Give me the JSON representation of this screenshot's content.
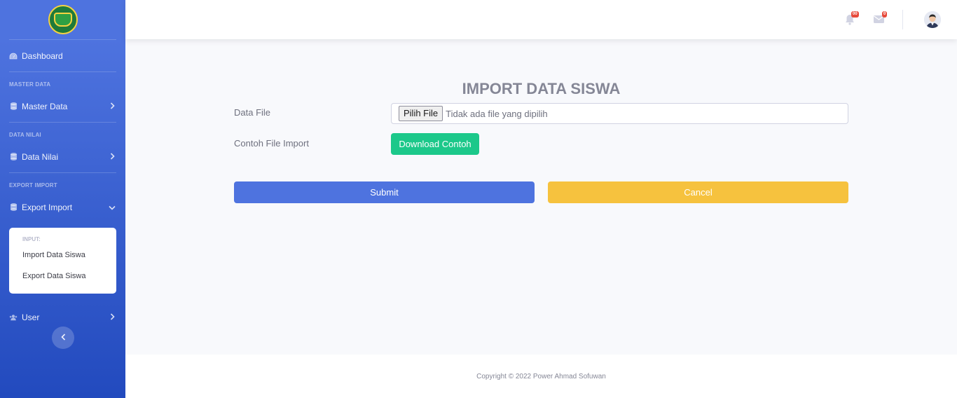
{
  "sidebar": {
    "logo_icon": "school-crest-logo",
    "dashboard_label": "Dashboard",
    "heading_master": "MASTER DATA",
    "master_label": "Master Data",
    "heading_nilai": "DATA NILAI",
    "nilai_label": "Data Nilai",
    "heading_export": "EXPORT IMPORT",
    "export_label": "Export Import",
    "submenu": {
      "heading": "INPUT:",
      "items": [
        "Import Data Siswa",
        "Export Data Siswa"
      ]
    },
    "user_label": "User",
    "toggle_icon": "chevron-left-icon"
  },
  "topbar": {
    "alerts_badge": "00",
    "messages_badge": "0"
  },
  "main": {
    "title": "IMPORT DATA SISWA",
    "data_file_label": "Data File",
    "file_button": "Pilih File",
    "file_status": "Tidak ada file yang dipilih",
    "example_label": "Contoh File Import",
    "download_button": "Download Contoh",
    "submit_button": "Submit",
    "cancel_button": "Cancel"
  },
  "footer": {
    "copyright": "Copyright © 2022 Power Ahmad Sofuwan"
  },
  "colors": {
    "primary": "#4e73df",
    "success": "#1cc88a",
    "warning": "#f6c23e",
    "danger": "#e74a3b"
  }
}
